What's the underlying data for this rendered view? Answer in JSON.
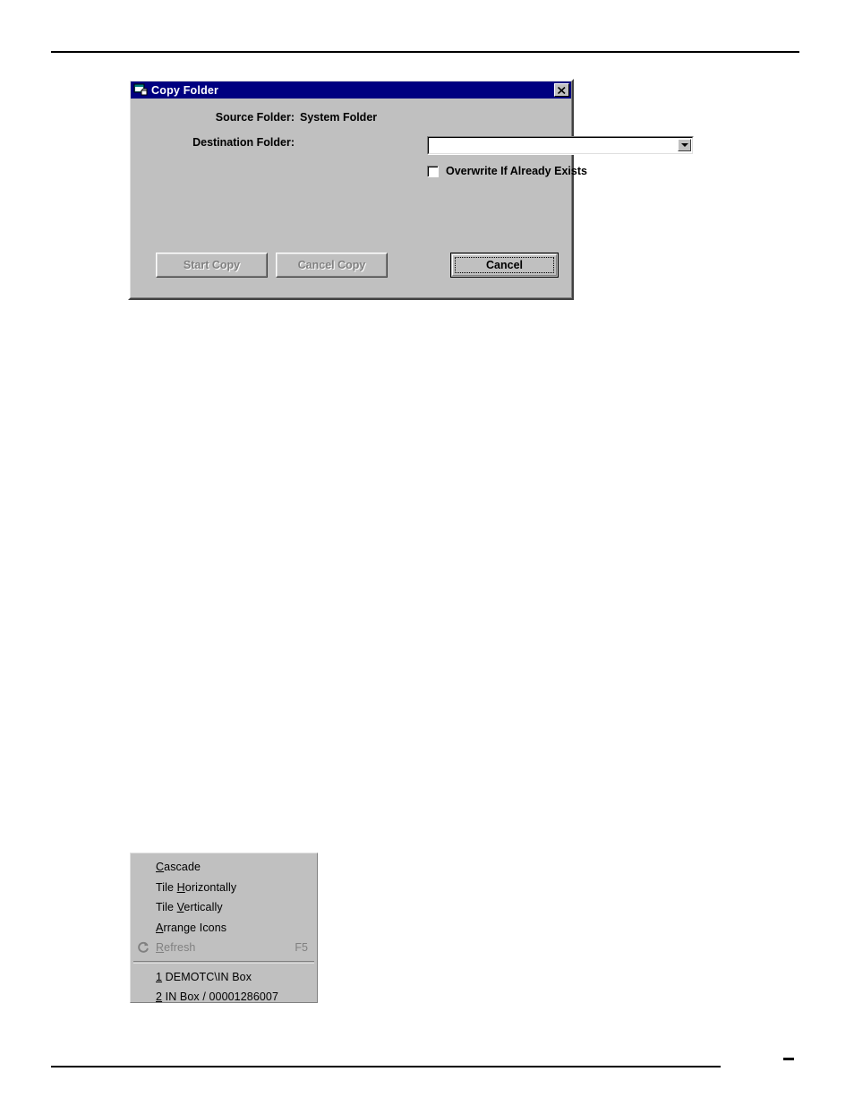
{
  "page": {
    "background": "#ffffff",
    "header_rule": true,
    "footer_rule": true,
    "footer_mark": "-"
  },
  "dialog": {
    "titlebar": {
      "title": "Copy Folder",
      "icon": "vb-form-folder-icon",
      "close_label": "✕",
      "bg_color": "#000080",
      "text_color": "#ffffff"
    },
    "face_color": "#c0c0c0",
    "fields": [
      {
        "name": "source-folder",
        "label": "Source Folder:",
        "value": "System Folder",
        "type": "static"
      },
      {
        "name": "destination-folder",
        "label": "Destination Folder:",
        "value": "",
        "placeholder": "",
        "type": "combobox",
        "options": []
      }
    ],
    "checkbox": {
      "label": "Overwrite If Already Exists",
      "checked": false
    },
    "buttons": [
      {
        "name": "start-copy",
        "label": "Start Copy",
        "enabled": false,
        "default": false
      },
      {
        "name": "cancel-copy",
        "label": "Cancel Copy",
        "enabled": false,
        "default": false
      },
      {
        "name": "cancel",
        "label": "Cancel",
        "enabled": true,
        "default": true,
        "focused": true
      }
    ]
  },
  "window_menu": {
    "face_color": "#c0c0c0",
    "items": [
      {
        "label": "Cascade",
        "mnemonic": "C",
        "pre": "",
        "post": "ascade",
        "accel": "",
        "enabled": true,
        "icon": ""
      },
      {
        "label": "Tile Horizontally",
        "mnemonic": "H",
        "pre": "Tile ",
        "post": "orizontally",
        "accel": "",
        "enabled": true,
        "icon": ""
      },
      {
        "label": "Tile Vertically",
        "mnemonic": "V",
        "pre": "Tile ",
        "post": "ertically",
        "accel": "",
        "enabled": true,
        "icon": ""
      },
      {
        "label": "Arrange Icons",
        "mnemonic": "A",
        "pre": "",
        "post": "rrange Icons",
        "accel": "",
        "enabled": true,
        "icon": ""
      },
      {
        "label": "Refresh",
        "mnemonic": "R",
        "pre": "",
        "post": "efresh",
        "accel": "F5",
        "enabled": false,
        "icon": "refresh-icon"
      },
      {
        "separator": true
      },
      {
        "label": "1 DEMOTC\\IN Box",
        "mnemonic": "1",
        "pre": "",
        "post": " DEMOTC\\IN Box",
        "accel": "",
        "enabled": true,
        "icon": ""
      },
      {
        "label": "2 IN Box / 00001286007",
        "mnemonic": "2",
        "pre": "",
        "post": " IN Box / 00001286007",
        "accel": "",
        "enabled": true,
        "icon": ""
      }
    ]
  }
}
